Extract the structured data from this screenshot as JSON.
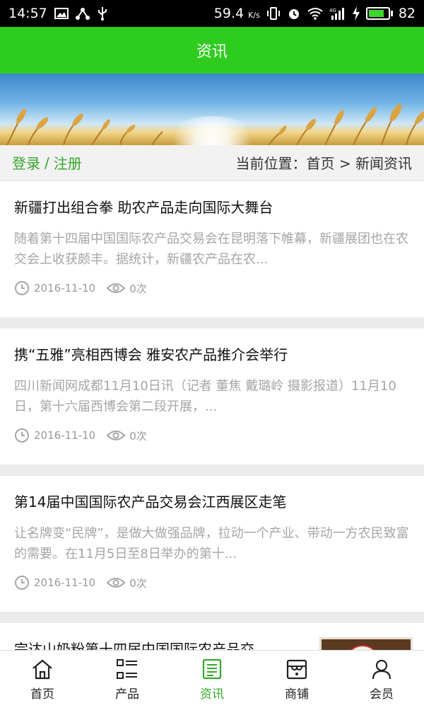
{
  "status_bar": {
    "time": "14:57",
    "speed": "59.4",
    "speed_unit": "K/s",
    "network": "4G",
    "battery": "82",
    "battery_level": 0.82
  },
  "header": {
    "title": "资讯"
  },
  "breadcrumb": {
    "login": "登录",
    "separator": "/",
    "register": "注册",
    "location": "当前位置：首页 > 新闻资讯"
  },
  "news": [
    {
      "title": "新疆打出组合拳 助农产品走向国际大舞台",
      "summary": "随着第十四届中国国际农产品交易会在昆明落下帷幕，新疆展团也在农交会上收获颇丰。据统计，新疆农产品在农...",
      "date": "2016-11-10",
      "views": "0次"
    },
    {
      "title": "携“五雅”亮相西博会 雅安农产品推介会举行",
      "summary": "四川新闻网成都11月10日讯（记者 董焦 戴璐岭 摄影报道）11月10日，第十六届西博会第二段开展，...",
      "date": "2016-11-10",
      "views": "0次"
    },
    {
      "title": "第14届中国国际农产品交易会江西展区走笔",
      "summary": "让名牌变“民牌”，是做大做强品牌，拉动一个产业、带动一方农民致富的需要。在11月5日至8日举办的第十...",
      "date": "2016-11-10",
      "views": "0次"
    },
    {
      "title": "完达山奶粉第十四届中国国际农产品交"
    }
  ],
  "tabs": [
    {
      "label": "首页",
      "icon": "home-icon"
    },
    {
      "label": "产品",
      "icon": "list-icon"
    },
    {
      "label": "资讯",
      "icon": "news-icon"
    },
    {
      "label": "商铺",
      "icon": "shop-icon"
    },
    {
      "label": "会员",
      "icon": "user-icon"
    }
  ],
  "colors": {
    "brand": "#2ecc1f",
    "active_tab": "#35a82a",
    "link": "#35a82a"
  }
}
